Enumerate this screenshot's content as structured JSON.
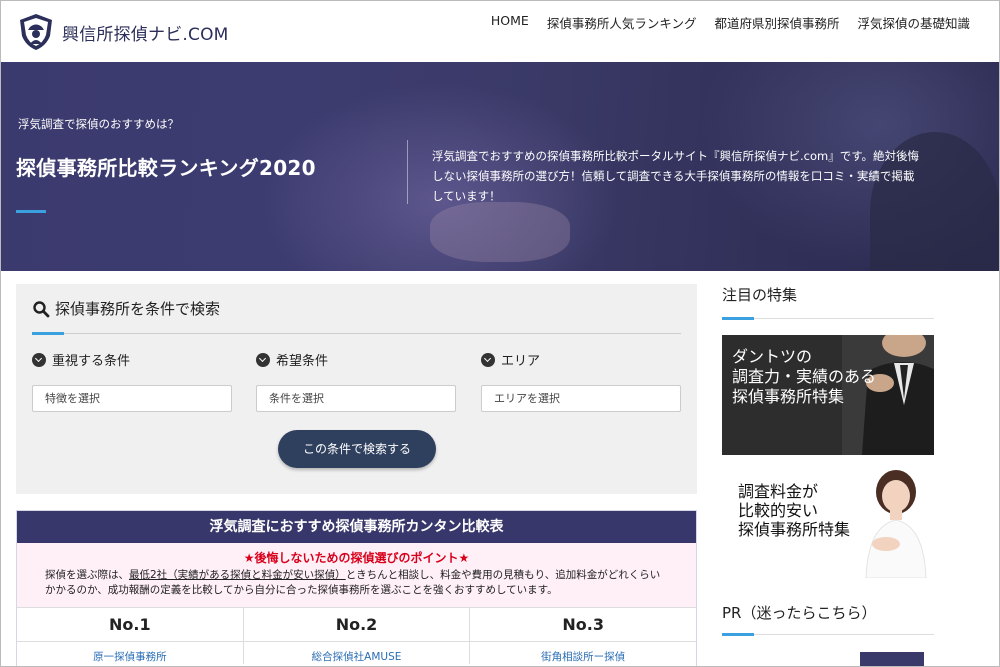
{
  "header": {
    "logo_text": "興信所探偵ナビ.COM",
    "nav": [
      "HOME",
      "探偵事務所人気ランキング",
      "都道府県別探偵事務所",
      "浮気探偵の基礎知識"
    ]
  },
  "hero": {
    "subtitle": "浮気調査で探偵のおすすめは？",
    "title": "探偵事務所比較ランキング2020",
    "description": "浮気調査でおすすめの探偵事務所比較ポータルサイト『興信所探偵ナビ.com』です。絶対後悔しない探偵事務所の選び方！信頼して調査できる大手探偵事務所の情報を口コミ・実績で掲載しています！"
  },
  "search": {
    "title": "探偵事務所を条件で検索",
    "filters": [
      {
        "label": "重視する条件",
        "placeholder": "特徴を選択"
      },
      {
        "label": "希望条件",
        "placeholder": "条件を選択"
      },
      {
        "label": "エリア",
        "placeholder": "エリアを選択"
      }
    ],
    "button": "この条件で検索する"
  },
  "comparison": {
    "title": "浮気調査におすすめ探偵事務所カンタン比較表",
    "point": "★後悔しないための探偵選びのポイント★",
    "text_pre": "探偵を選ぶ際は、",
    "text_ul": "最低2社（実績がある探偵と料金が安い探偵）",
    "text_post": "ときちんと相談し、料金や費用の見積もり、追加料金がどれくらいかかるのか、成功報酬の定義を比較してから自分に合った探偵事務所を選ぶことを強くおすすめしています。",
    "columns": [
      {
        "rank": "No.1",
        "name": "原一探偵事務所"
      },
      {
        "rank": "No.2",
        "name": "総合探偵社AMUSE"
      },
      {
        "rank": "No.3",
        "name": "街角相談所ー探偵"
      }
    ]
  },
  "sidebar": {
    "featured_heading": "注目の特集",
    "banner1": [
      "ダントツの",
      "調査力・実績のある",
      "探偵事務所特集"
    ],
    "banner2": [
      "調査料金が",
      "比較的安い",
      "探偵事務所特集"
    ],
    "pr_heading": "PR（迷ったらこちら）"
  },
  "colors": {
    "hero_bg": "#3b3a6e",
    "accent": "#3aa0e0",
    "search_button": "#2f3f5e",
    "table_head": "#38376b",
    "point_red": "#d9001b",
    "link_blue": "#2a6db5"
  }
}
